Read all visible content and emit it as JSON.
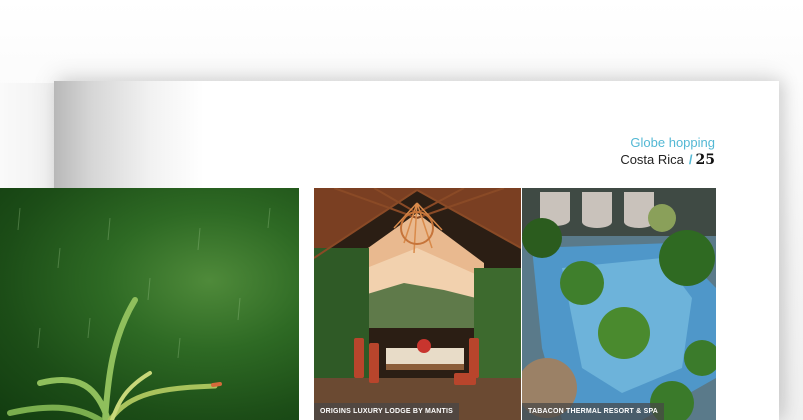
{
  "header": {
    "section": "Globe hopping",
    "title": "Costa Rica",
    "page_number": "25"
  },
  "photos": [
    {
      "caption": "ORIGINS LUXURY LODGE BY MANTIS"
    },
    {
      "caption": "TABACON THERMAL RESORT & SPA"
    }
  ],
  "colors": {
    "accent": "#53b8d4",
    "forest": "#2e6a24",
    "pool": "#4f97c9"
  }
}
